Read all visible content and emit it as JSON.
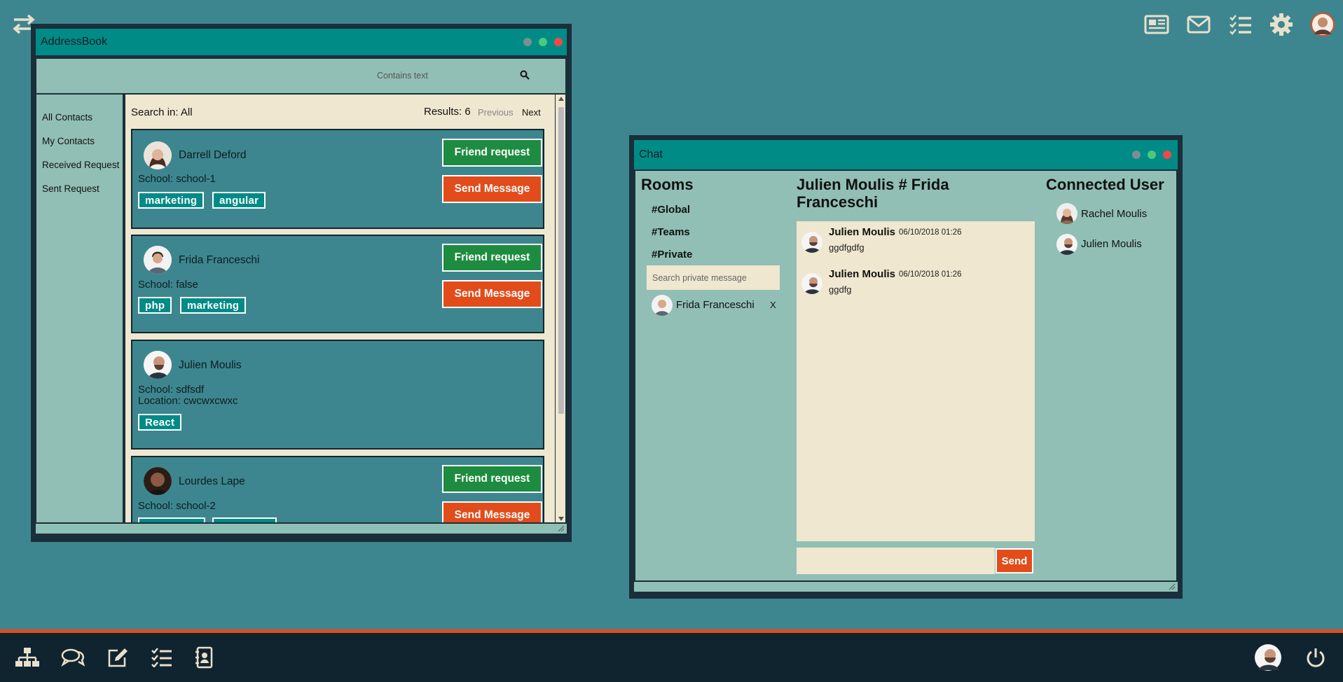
{
  "desktop": {
    "top_icons": [
      "news-icon",
      "mail-icon",
      "tasks-icon",
      "settings-icon",
      "user-avatar"
    ]
  },
  "addressbook": {
    "title": "AddressBook",
    "search_placeholder": "Contains text",
    "sidebar": [
      "All Contacts",
      "My Contacts",
      "Received Request",
      "Sent Request"
    ],
    "search_in": "Search in: All",
    "results": "Results: 6",
    "previous": "Previous",
    "next": "Next",
    "contacts": [
      {
        "name": "Darrell Deford",
        "school": "School: school-1",
        "tags": [
          "marketing",
          "angular"
        ],
        "friend_label": "Friend request",
        "message_label": "Send Message"
      },
      {
        "name": "Frida Franceschi",
        "school": "School: false",
        "tags": [
          "php",
          "marketing"
        ],
        "friend_label": "Friend request",
        "message_label": "Send Message"
      },
      {
        "name": "Julien Moulis",
        "school": "School: sdfsdf",
        "location": "Location: cwcwxcwxc",
        "tags": [
          "React"
        ]
      },
      {
        "name": "Lourdes Lape",
        "school": "School: school-2",
        "tags": [
          "",
          ""
        ],
        "friend_label": "Friend request",
        "message_label": "Send Message"
      }
    ]
  },
  "chat": {
    "title": "Chat",
    "rooms_title": "Rooms",
    "rooms": [
      "#Global",
      "#Teams",
      "#Private"
    ],
    "private_search_placeholder": "Search private message",
    "private_contact": "Frida Franceschi",
    "private_close": "X",
    "conversation_title": "Julien Moulis # Frida Franceschi",
    "messages": [
      {
        "author": "Julien Moulis",
        "time": "06/10/2018 01:26",
        "text": "ggdfgdfg"
      },
      {
        "author": "Julien Moulis",
        "time": "06/10/2018 01:26",
        "text": "ggdfg"
      }
    ],
    "send_label": "Send",
    "connected_title": "Connected User",
    "connected_users": [
      "Rachel Moulis",
      "Julien Moulis"
    ]
  },
  "taskbar": {
    "icons": [
      "sitemap-icon",
      "chat-icon",
      "edit-icon",
      "tasks-icon",
      "contacts-icon"
    ],
    "right": [
      "user-avatar",
      "power-icon"
    ]
  },
  "colors": {
    "background": "#3d868f",
    "titlebar": "#008b87",
    "panel": "#91bfb5",
    "content": "#efe7cf",
    "green": "#1e8c40",
    "orange": "#e24c1b",
    "taskbar": "#102430"
  }
}
